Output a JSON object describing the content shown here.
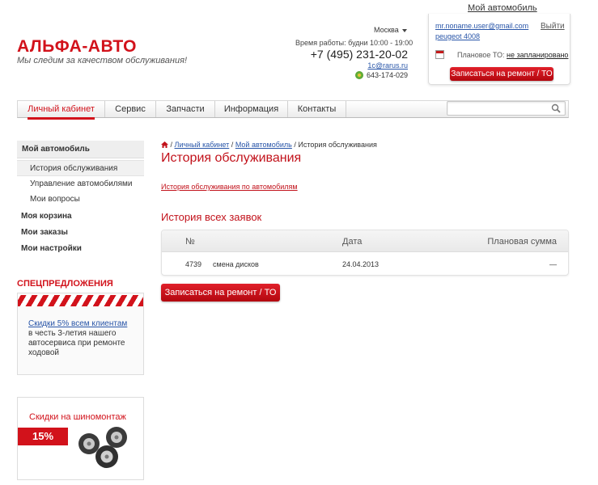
{
  "header": {
    "logo": "АЛЬФА-АВТО",
    "slogan": "Мы следим за качеством обслуживания!",
    "city": "Москва",
    "hours": "Время работы: будни 10:00 - 19:00",
    "phone": "+7 (495) 231-20-02",
    "email": "1c@rarus.ru",
    "icq": "643-174-029"
  },
  "account": {
    "title": "Мой автомобиль",
    "email": "mr.noname.user@gmail.com",
    "logout": "Выйти",
    "car": "peugeot 4008",
    "plan_label": "Плановое ТО:",
    "plan_value": "не запланировано",
    "button": "Записаться на ремонт / ТО"
  },
  "nav": {
    "items": [
      "Личный кабинет",
      "Сервис",
      "Запчасти",
      "Информация",
      "Контакты"
    ],
    "search_placeholder": ""
  },
  "sidebar": {
    "head": "Мой автомобиль",
    "sub": [
      "История обслуживания",
      "Управление автомобилями",
      "Мои вопросы"
    ],
    "sections": [
      "Моя корзина",
      "Мои заказы",
      "Мои настройки"
    ]
  },
  "promo": {
    "title": "СПЕЦПРЕДЛОЖЕНИЯ",
    "link": "Скидки 5% всем клиентам",
    "text": "в честь 3-летия нашего автосервиса при ремонте ходовой",
    "tire_title": "Скидки на шиномонтаж",
    "tire_badge": "15%"
  },
  "breadcrumb": {
    "items": [
      "Личный кабинет",
      "Мой автомобиль"
    ],
    "sep": "/",
    "current": "История обслуживания"
  },
  "main": {
    "title": "История обслуживания",
    "by_cars_link": "История обслуживания по автомобилям",
    "section_title": "История всех заявок",
    "table": {
      "headers": [
        "№",
        "Дата",
        "Плановая сумма"
      ],
      "rows": [
        {
          "num": "4739",
          "desc": "смена дисков",
          "date": "24.04.2013",
          "sum": "—"
        }
      ]
    },
    "button": "Записаться на ремонт / ТО"
  },
  "colors": {
    "brand": "#d2121b",
    "link": "#2855a8"
  }
}
